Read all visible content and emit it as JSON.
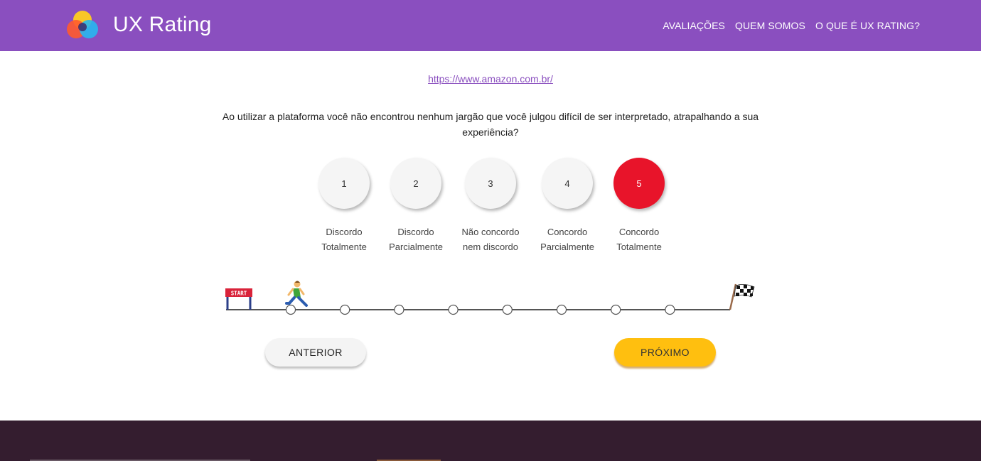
{
  "header": {
    "brand": "UX Rating",
    "logo_icon": "overlapping-circles-logo",
    "nav": [
      "AVALIAÇÕES",
      "QUEM SOMOS",
      "O QUE É UX RATING?"
    ],
    "background_color": "#8a4fbf"
  },
  "survey": {
    "site_url": "https://www.amazon.com.br/",
    "question": "Ao utilizar a plataforma você não encontrou nenhum jargão que você julgou difícil de ser interpretado, atrapalhando a sua experiência?",
    "options": [
      {
        "value": "1",
        "line1": "Discordo",
        "line2": "Totalmente"
      },
      {
        "value": "2",
        "line1": "Discordo",
        "line2": "Parcialmente"
      },
      {
        "value": "3",
        "line1": "Não concordo",
        "line2": "nem discordo"
      },
      {
        "value": "4",
        "line1": "Concordo",
        "line2": "Parcialmente"
      },
      {
        "value": "5",
        "line1": "Concordo",
        "line2": "Totalmente"
      }
    ],
    "selected_value": "5",
    "selected_color": "#e8142a"
  },
  "progress": {
    "start_sign": "START",
    "start_icon": "start-sign-icon",
    "runner_icon": "runner-icon",
    "finish_icon": "checkered-flag-icon",
    "total_steps": 8,
    "current_step": 1
  },
  "buttons": {
    "prev_label": "ANTERIOR",
    "next_label": "PRÓXIMO",
    "next_color": "#ffbf0f"
  },
  "footer": {
    "background_color": "#341d2f"
  }
}
